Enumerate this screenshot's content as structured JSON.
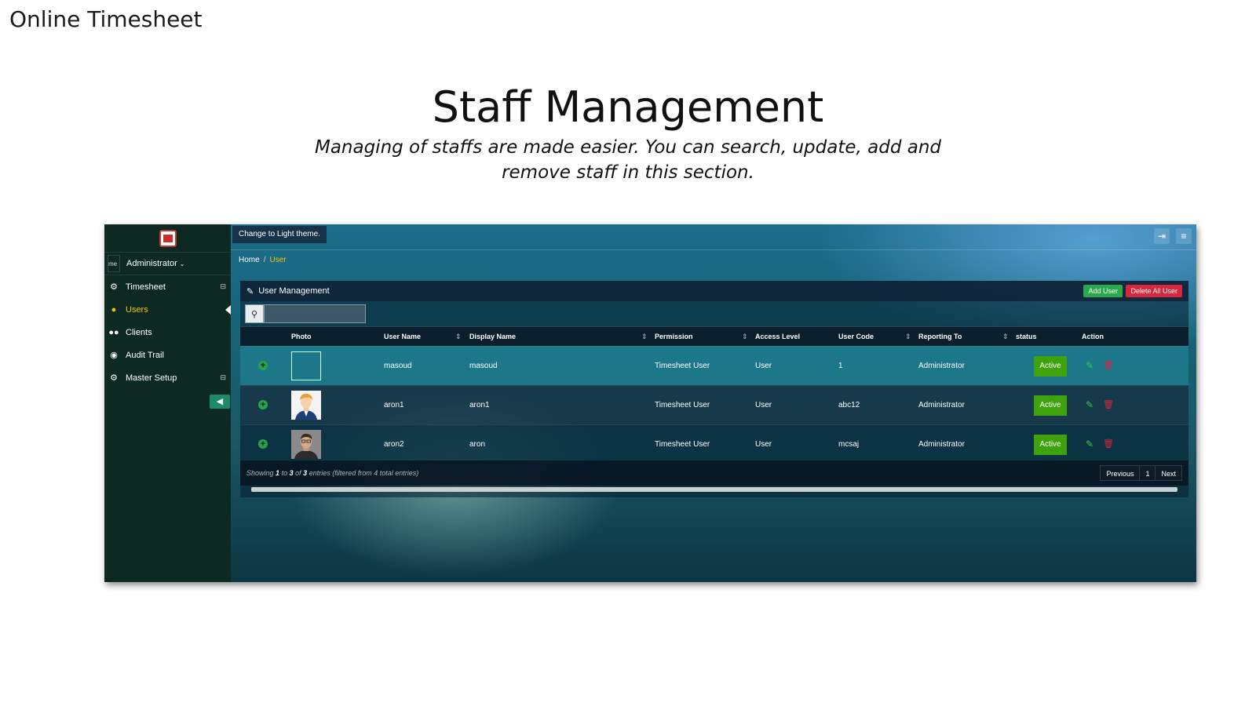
{
  "slide": {
    "label": "Online Timesheet",
    "title": "Staff Management",
    "subtitle_line1": "Managing of staffs are made easier. You can search, update, add and",
    "subtitle_line2": "remove staff in this section."
  },
  "sidebar": {
    "user_name": "Administrator",
    "avatar_alt": "me",
    "items": [
      {
        "label": "Timesheet",
        "icon": "gears-icon",
        "indicator": "⊟"
      },
      {
        "label": "Users",
        "icon": "user-icon",
        "active": true
      },
      {
        "label": "Clients",
        "icon": "users-icon"
      },
      {
        "label": "Audit Trail",
        "icon": "eye-icon"
      },
      {
        "label": "Master Setup",
        "icon": "gears-icon",
        "indicator": "⊟"
      }
    ]
  },
  "topbar": {
    "theme_button": "Change to Light theme."
  },
  "breadcrumb": {
    "home": "Home",
    "separator": "/",
    "current": "User"
  },
  "panel": {
    "title": "User Management",
    "add_button": "Add User",
    "delete_all_button": "Delete All User",
    "search_placeholder": ""
  },
  "table": {
    "headers": {
      "photo": "Photo",
      "user_name": "User Name",
      "display_name": "Display Name",
      "permission": "Permission",
      "access_level": "Access Level",
      "user_code": "User Code",
      "reporting_to": "Reporting To",
      "status": "status",
      "action": "Action"
    },
    "rows": [
      {
        "user_name": "masoud",
        "display_name": "masoud",
        "permission": "Timesheet User",
        "access_level": "User",
        "user_code": "1",
        "reporting_to": "Administrator",
        "status": "Active"
      },
      {
        "user_name": "aron1",
        "display_name": "aron1",
        "permission": "Timesheet User",
        "access_level": "User",
        "user_code": "abc12",
        "reporting_to": "Administrator",
        "status": "Active"
      },
      {
        "user_name": "aron2",
        "display_name": "aron",
        "permission": "Timesheet User",
        "access_level": "User",
        "user_code": "mcsaj",
        "reporting_to": "Administrator",
        "status": "Active"
      }
    ]
  },
  "footer": {
    "info_prefix": "Showing",
    "info_from": "1",
    "info_to_word": "to",
    "info_to": "3",
    "info_of_word": "of",
    "info_total": "3",
    "info_suffix": "entries (filtered from 4 total entries)",
    "previous": "Previous",
    "page": "1",
    "next": "Next"
  },
  "colors": {
    "accent_yellow": "#f3c300",
    "add_green": "#2aa84c",
    "delete_red": "#d7263d",
    "status_green": "#3ea20c"
  }
}
